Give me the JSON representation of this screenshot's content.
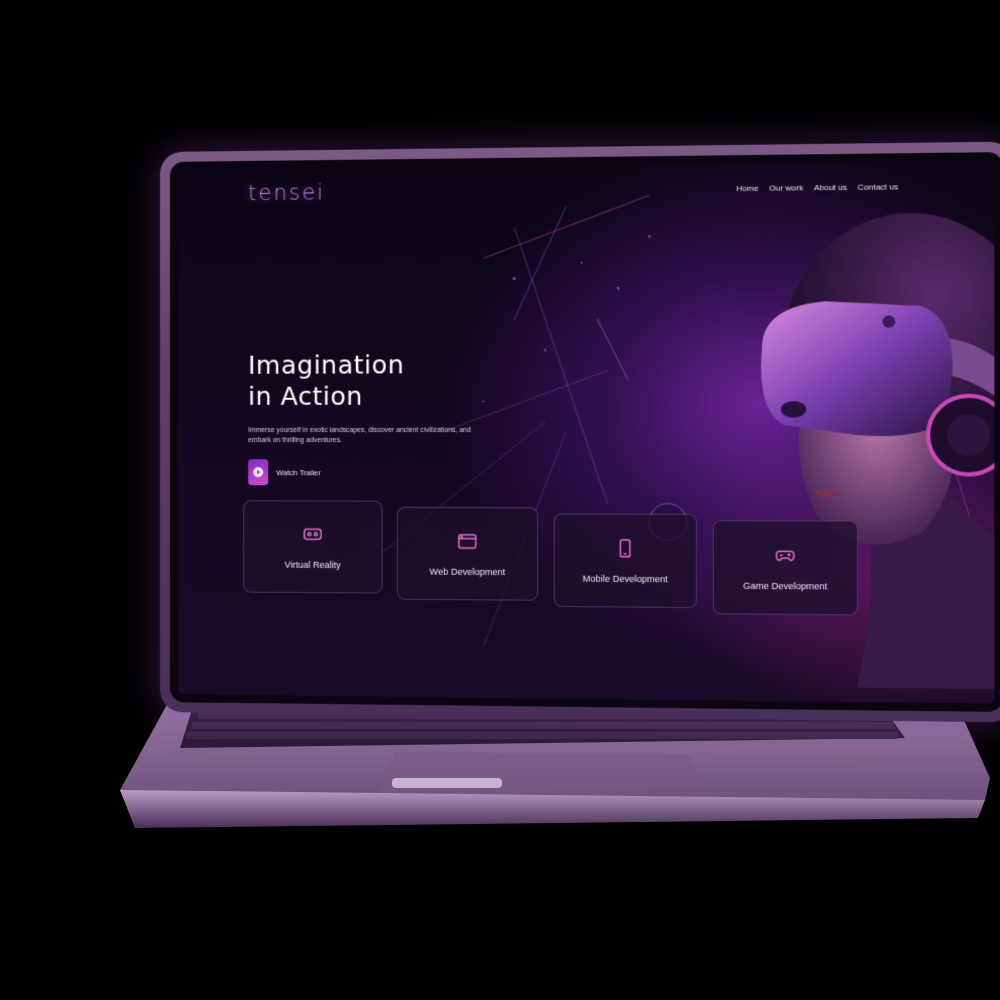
{
  "brand": {
    "logo_text": "tensei",
    "accent": "#c77ee6"
  },
  "nav": {
    "items": [
      {
        "label": "Home"
      },
      {
        "label": "Our work"
      },
      {
        "label": "About us"
      },
      {
        "label": "Contact us"
      }
    ]
  },
  "hero": {
    "title_line1": "Imagination",
    "title_line2": "in Action",
    "description": "Immerse yourself in exotic landscapes, discover ancient civilizations, and embark on thrilling adventures.",
    "cta_label": "Watch Trailer",
    "cta_icon": "play-icon"
  },
  "services": [
    {
      "label": "Virtual Reality",
      "icon": "vr-headset-icon"
    },
    {
      "label": "Web Development",
      "icon": "browser-window-icon"
    },
    {
      "label": "Mobile Development",
      "icon": "smartphone-icon"
    },
    {
      "label": "Game Development",
      "icon": "gamepad-icon"
    }
  ],
  "colors": {
    "background": "#0b0514",
    "card_border": "#a078be",
    "laptop_body": "#6b4a78"
  }
}
